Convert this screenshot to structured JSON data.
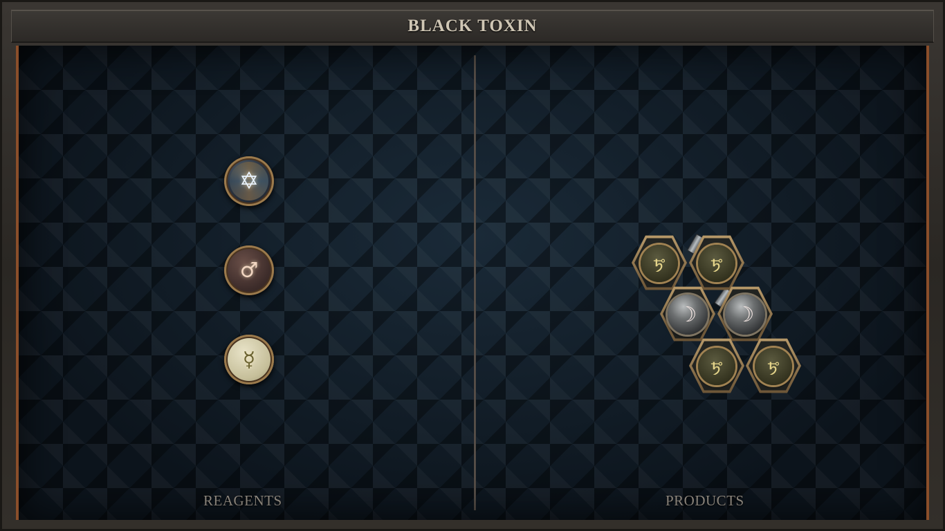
{
  "title": "BLACK TOXIN",
  "sections": {
    "reagents_label": "REAGENTS",
    "products_label": "PRODUCTS"
  },
  "reagents": [
    {
      "name": "salt",
      "icon": "salt-star-icon",
      "symbol": "✡"
    },
    {
      "name": "mars",
      "icon": "mars-icon",
      "symbol": "♂"
    },
    {
      "name": "mercury",
      "icon": "mercury-icon",
      "symbol": "☿"
    }
  ],
  "products": {
    "atoms": [
      {
        "element": "lead",
        "symbol": "🜪"
      },
      {
        "element": "lead",
        "symbol": "🜪"
      },
      {
        "element": "silver",
        "symbol": "☽"
      },
      {
        "element": "silver",
        "symbol": "☽"
      },
      {
        "element": "lead",
        "symbol": "🜪"
      },
      {
        "element": "lead",
        "symbol": "🜪"
      }
    ]
  },
  "colors": {
    "frame_accent": "#8a4e2a",
    "background": "#101922",
    "title_text": "#cfc6b4",
    "label_text": "#9d968c"
  }
}
